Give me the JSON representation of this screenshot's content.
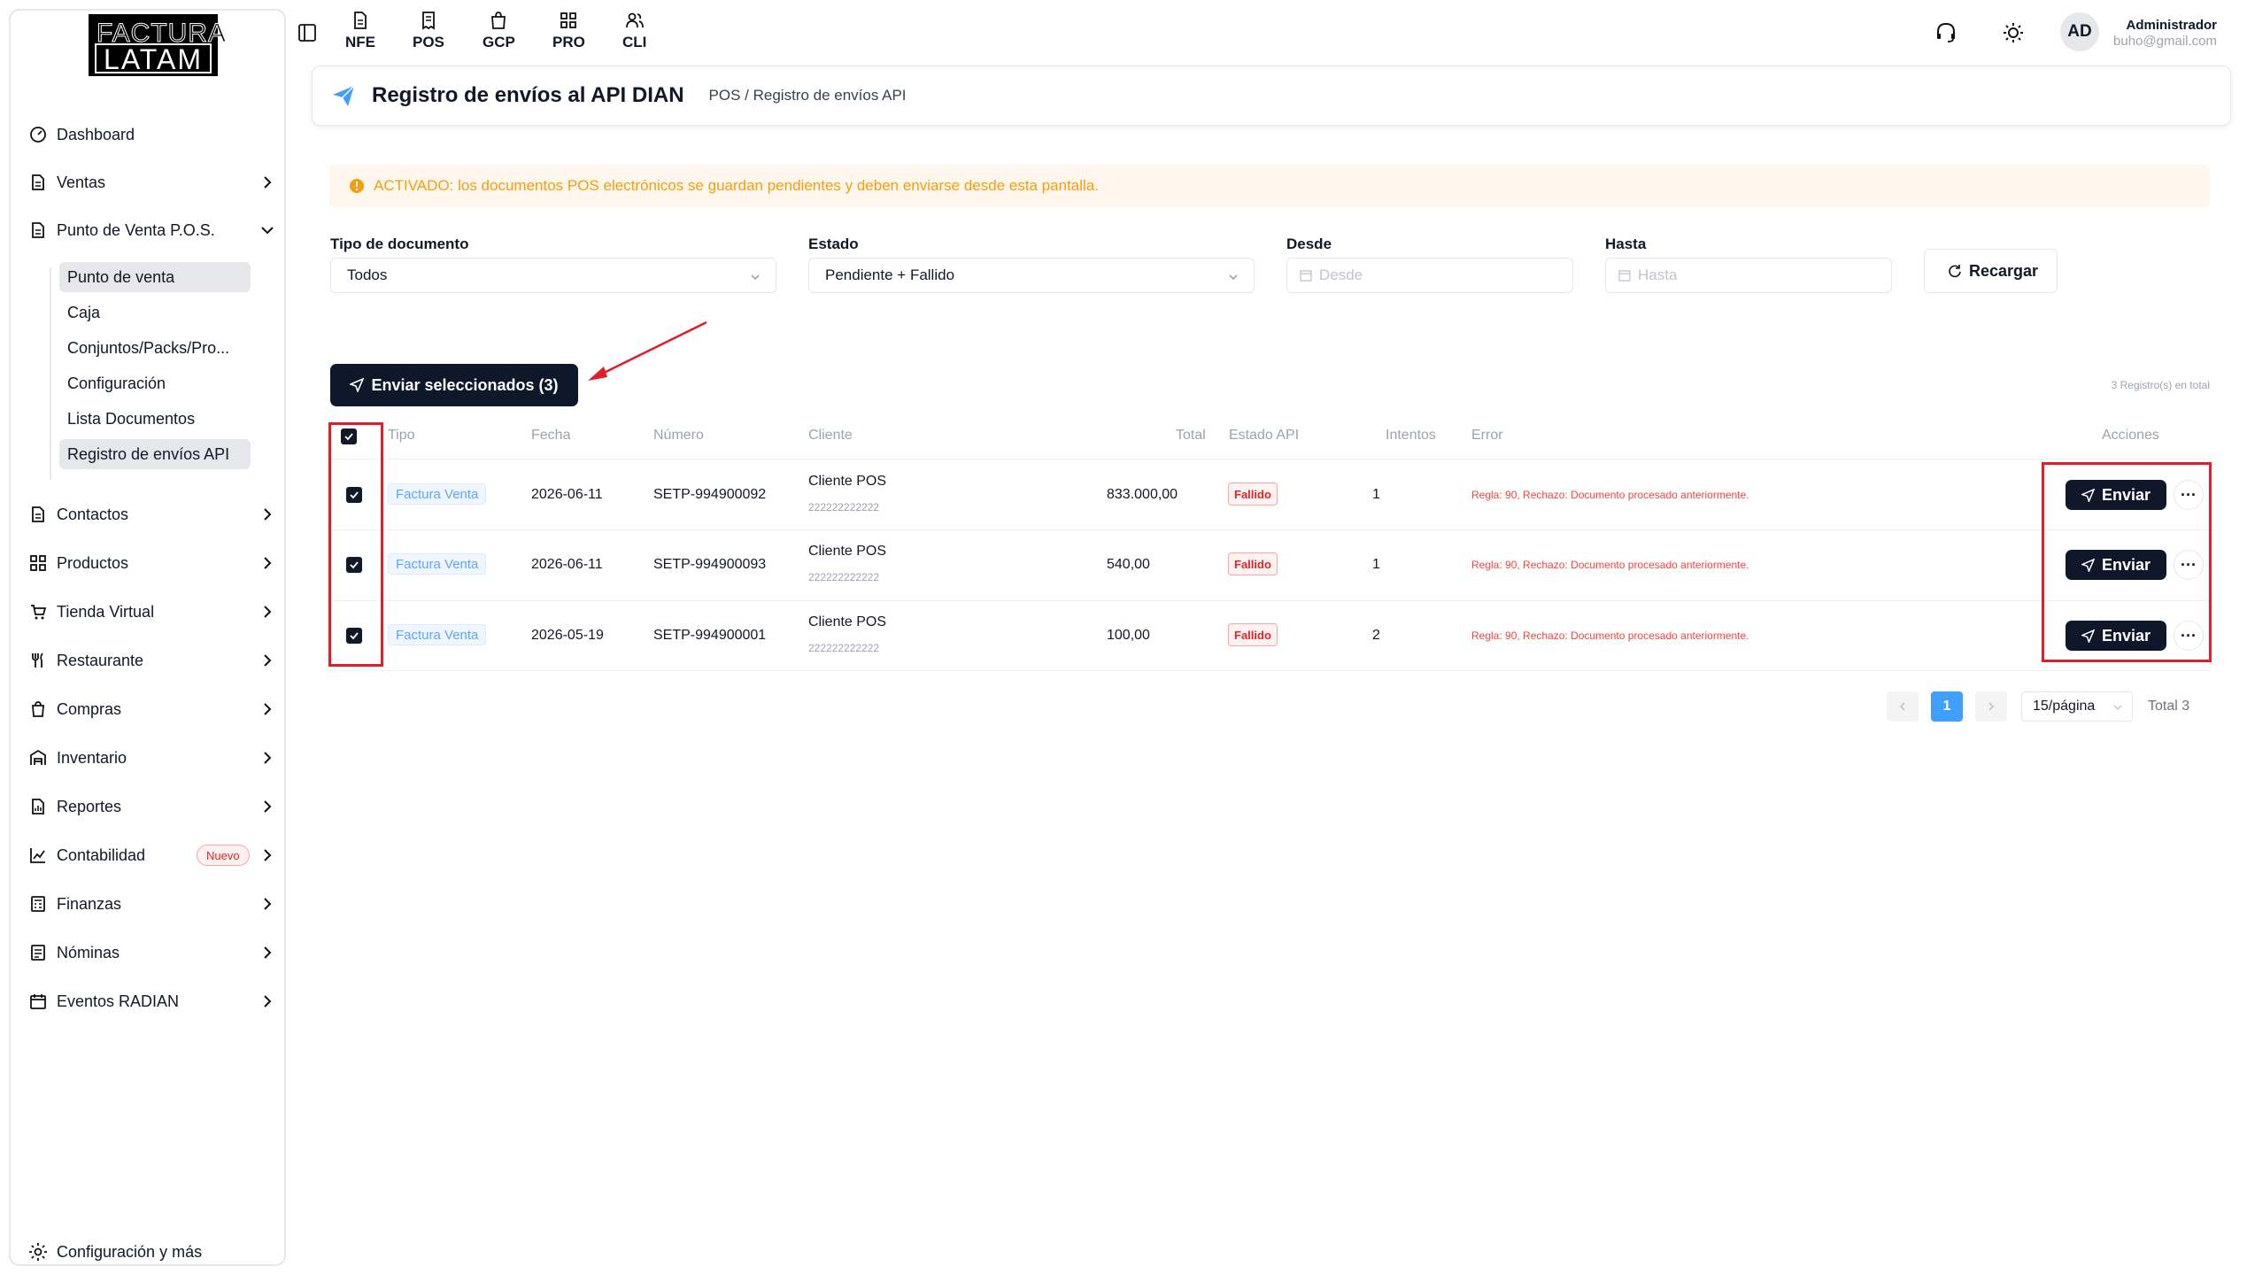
{
  "logo": {
    "line1": "FACTURA",
    "line2": "LATAM"
  },
  "sidebar": {
    "items": [
      {
        "label": "Dashboard",
        "icon": "gauge-icon"
      },
      {
        "label": "Ventas",
        "icon": "document-icon"
      },
      {
        "label": "Punto de Venta P.O.S.",
        "icon": "document-icon"
      },
      {
        "label": "Contactos",
        "icon": "document-icon"
      },
      {
        "label": "Productos",
        "icon": "grid-icon"
      },
      {
        "label": "Tienda Virtual",
        "icon": "cart-icon"
      },
      {
        "label": "Restaurante",
        "icon": "utensils-icon"
      },
      {
        "label": "Compras",
        "icon": "bag-icon"
      },
      {
        "label": "Inventario",
        "icon": "warehouse-icon"
      },
      {
        "label": "Reportes",
        "icon": "report-icon"
      },
      {
        "label": "Contabilidad",
        "icon": "chart-icon",
        "badge": "Nuevo"
      },
      {
        "label": "Finanzas",
        "icon": "calculator-icon"
      },
      {
        "label": "Nóminas",
        "icon": "payroll-icon"
      },
      {
        "label": "Eventos RADIAN",
        "icon": "calendar-icon"
      }
    ],
    "pos_sub_items": [
      "Punto de venta",
      "Caja",
      "Conjuntos/Packs/Pro...",
      "Configuración",
      "Lista Documentos",
      "Registro de envíos API"
    ],
    "settings_label": "Configuración y más"
  },
  "topbar": {
    "modules": [
      "NFE",
      "POS",
      "GCP",
      "PRO",
      "CLI"
    ],
    "user": {
      "initials": "AD",
      "name": "Administrador",
      "email": "buho@gmail.com"
    }
  },
  "header": {
    "title": "Registro de envíos al API DIAN",
    "breadcrumb": "POS / Registro de envíos API"
  },
  "alert": {
    "text": "ACTIVADO: los documentos POS electrónicos se guardan pendientes y deben enviarse desde esta pantalla."
  },
  "filters": {
    "doc_type_label": "Tipo de documento",
    "doc_type_value": "Todos",
    "status_label": "Estado",
    "status_value": "Pendiente + Fallido",
    "from_label": "Desde",
    "from_placeholder": "Desde",
    "to_label": "Hasta",
    "to_placeholder": "Hasta",
    "reload_label": "Recargar"
  },
  "bulk": {
    "send_selected_label": "Enviar seleccionados (3)",
    "records_count": "3 Registro(s) en total"
  },
  "table": {
    "columns": [
      "Tipo",
      "Fecha",
      "Número",
      "Cliente",
      "Total",
      "Estado API",
      "Intentos",
      "Error",
      "Acciones"
    ],
    "rows": [
      {
        "type": "Factura Venta",
        "date": "2026-06-11",
        "number": "SETP-994900092",
        "client": "Cliente POS",
        "client_id": "222222222222",
        "total": "833.000,00",
        "status": "Fallido",
        "attempts": "1",
        "error": "Regla: 90, Rechazo: Documento procesado anteriormente.",
        "action": "Enviar"
      },
      {
        "type": "Factura Venta",
        "date": "2026-06-11",
        "number": "SETP-994900093",
        "client": "Cliente POS",
        "client_id": "222222222222",
        "total": "540,00",
        "status": "Fallido",
        "attempts": "1",
        "error": "Regla: 90, Rechazo: Documento procesado anteriormente.",
        "action": "Enviar"
      },
      {
        "type": "Factura Venta",
        "date": "2026-05-19",
        "number": "SETP-994900001",
        "client": "Cliente POS",
        "client_id": "222222222222",
        "total": "100,00",
        "status": "Fallido",
        "attempts": "2",
        "error": "Regla: 90, Rechazo: Documento procesado anteriormente.",
        "action": "Enviar"
      }
    ]
  },
  "pagination": {
    "current_page": "1",
    "page_size": "15/página",
    "total": "Total 3"
  },
  "colors": {
    "accent_blue": "#409eff",
    "dark_button": "#0f172a",
    "annotation_red": "#e11d2a",
    "warning": "#f59e0b"
  }
}
